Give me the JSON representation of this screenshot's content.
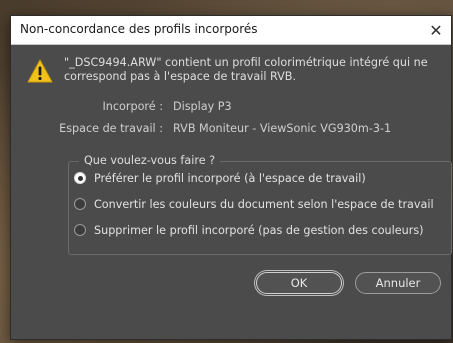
{
  "dialog": {
    "title": "Non-concordance des profils incorporés",
    "close_glyph": "✕",
    "message_line1": "\"_DSC9494.ARW\" contient un profil colorimétrique intégré qui ne",
    "message_line2": "correspond pas à l'espace de travail RVB.",
    "embedded_label": "Incorporé :",
    "embedded_value": "Display P3",
    "working_label": "Espace de travail :",
    "working_value": "RVB Moniteur - ViewSonic VG930m-3-1",
    "group_title": "Que voulez-vous faire ?",
    "options": [
      {
        "label": "Préférer le profil incorporé (à l'espace de travail)",
        "selected": true
      },
      {
        "label": "Convertir les couleurs du document selon l'espace de travail",
        "selected": false
      },
      {
        "label": "Supprimer le profil incorporé (pas de gestion des couleurs)",
        "selected": false
      }
    ],
    "ok_label": "OK",
    "cancel_label": "Annuler"
  },
  "icons": {
    "warning": "warning-icon",
    "close": "close-icon"
  },
  "colors": {
    "dialog_bg": "#4b4b4b",
    "warning_yellow": "#f2c21b"
  }
}
